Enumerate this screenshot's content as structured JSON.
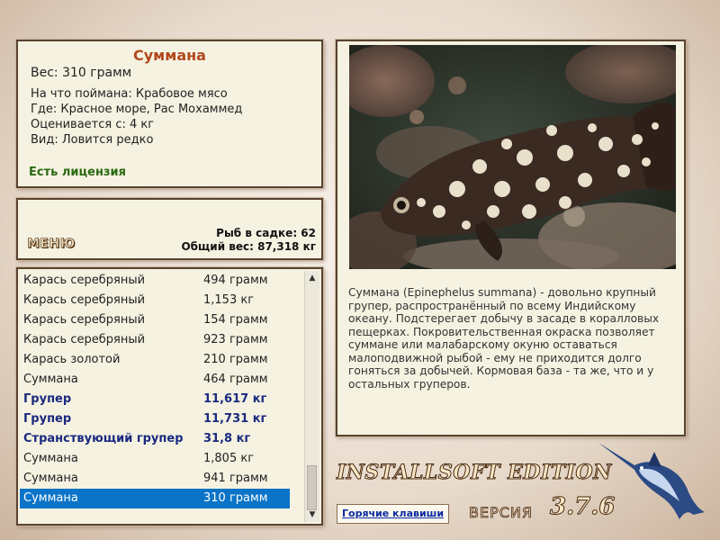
{
  "fish": {
    "title": "Суммана",
    "weight": "Вес: 310 грамм",
    "caught_on": "На что поймана: Крабовое мясо",
    "where": "Где: Красное море, Рас Мохаммед",
    "rated_from": "Оценивается с: 4 кг",
    "species": "Вид: Ловится редко",
    "license": "Есть лицензия"
  },
  "menu": {
    "label": "МЕНЮ"
  },
  "stats": {
    "fish_in_net": "Рыб в садке: 62",
    "total_weight": "Общий вес: 87,318 кг"
  },
  "catch_list": [
    {
      "name": "Карась серебряный",
      "weight": "494 грамм"
    },
    {
      "name": "Карась серебряный",
      "weight": "1,153 кг"
    },
    {
      "name": "Карась серебряный",
      "weight": "154 грамм"
    },
    {
      "name": "Карась серебряный",
      "weight": "923 грамм"
    },
    {
      "name": "Карась золотой",
      "weight": "210 грамм"
    },
    {
      "name": "Суммана",
      "weight": "464 грамм"
    },
    {
      "name": "Групер",
      "weight": "11,617 кг"
    },
    {
      "name": "Групер",
      "weight": "11,731 кг"
    },
    {
      "name": "Странствующий групер",
      "weight": "31,8 кг"
    },
    {
      "name": "Суммана",
      "weight": "1,805 кг"
    },
    {
      "name": "Суммана",
      "weight": "941 грамм"
    },
    {
      "name": "Суммана",
      "weight": "310 грамм"
    }
  ],
  "description": "Суммана (Epinephelus summana) - довольно крупный групер, распространённый по всему Индийскому океану. Подстерегает добычу в засаде в коралловых пещерках. Покровительственная окраска позволяет суммане или малабарскому окуню оставаться малоподвижной рыбой - ему не приходится долго гоняться за добычей. Кормовая база - та же, что и у остальных груперов.",
  "hotkeys": "Горячие клавиши",
  "edition": "INSTALLSOFT EDITION",
  "version_label": "ВЕРСИЯ",
  "version": "3.7.6",
  "colors": {
    "title": "#b2481e",
    "license": "#2b6a12",
    "highlight_row": "#1a2a80",
    "selected_row": "#0b74c8"
  }
}
